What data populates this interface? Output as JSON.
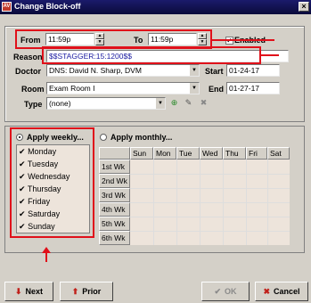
{
  "window": {
    "title": "Change Block-off",
    "app_icon": "AV"
  },
  "form": {
    "from_label": "From",
    "from_value": "11:59p",
    "to_label": "To",
    "to_value": "11:59p",
    "enabled_label": "Enabled",
    "reason_label": "Reason",
    "reason_value": "$$STAGGER:15:1200$$",
    "doctor_label": "Doctor",
    "doctor_value": "DNS: David N. Sharp, DVM",
    "start_label": "Start",
    "start_value": "01-24-17",
    "room_label": "Room",
    "room_value": "Exam Room I",
    "end_label": "End",
    "end_value": "01-27-17",
    "type_label": "Type",
    "type_value": "(none)"
  },
  "weekly": {
    "label": "Apply weekly...",
    "days": [
      "Monday",
      "Tuesday",
      "Wednesday",
      "Thursday",
      "Friday",
      "Saturday",
      "Sunday"
    ]
  },
  "monthly": {
    "label": "Apply monthly...",
    "columns": [
      "Sun",
      "Mon",
      "Tue",
      "Wed",
      "Thu",
      "Fri",
      "Sat"
    ],
    "rows": [
      "1st Wk",
      "2nd Wk",
      "3rd Wk",
      "4th Wk",
      "5th Wk",
      "6th Wk"
    ]
  },
  "buttons": {
    "next": "Next",
    "prior": "Prior",
    "ok": "OK",
    "cancel": "Cancel"
  },
  "colors": {
    "annotation_red": "#e0101a",
    "titlebar": "#0b0b3a"
  }
}
